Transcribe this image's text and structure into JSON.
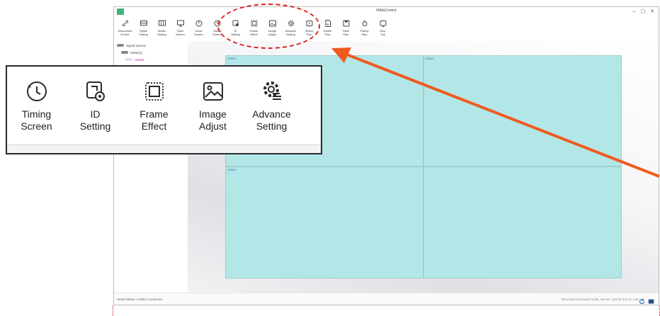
{
  "window": {
    "title": "MiMaControl",
    "controls": [
      "–",
      "▢",
      "✕"
    ]
  },
  "toolbar": {
    "buttons": [
      {
        "label": "Disconnect\nDevice",
        "icon": "link-icon"
      },
      {
        "label": "Splice\nSetting",
        "icon": "splice-icon"
      },
      {
        "label": "Matrix\nSetting",
        "icon": "matrix-icon"
      },
      {
        "label": "Open\nScreen",
        "icon": "monitor-icon"
      },
      {
        "label": "Close\nScreen",
        "icon": "power-icon"
      },
      {
        "label": "Timing\nScreen",
        "icon": "clock-icon"
      },
      {
        "label": "ID\nSetting",
        "icon": "id-icon"
      },
      {
        "label": "Frame\nEffect",
        "icon": "frame-icon"
      },
      {
        "label": "Image\nAdjust",
        "icon": "image-icon"
      },
      {
        "label": "Advance\nSetting",
        "icon": "gear-icon"
      },
      {
        "label": "Select\nPlan",
        "icon": "select-icon"
      },
      {
        "label": "Delete\nPlan",
        "icon": "delete-icon"
      },
      {
        "label": "Save\nPlan",
        "icon": "save-icon"
      },
      {
        "label": "Polling\nPlan",
        "icon": "polling-icon"
      },
      {
        "label": "Help\nTool",
        "icon": "help-icon"
      }
    ]
  },
  "sidebar": {
    "root": "Signal Source",
    "group": "HDMI(1)",
    "item": "HDMI1"
  },
  "canvas": {
    "cells": [
      "HDMI1",
      "HDMI1",
      "HDMI1",
      ""
    ],
    "fill_color": "#b3e6e6"
  },
  "status": {
    "left": "Serial Status: COM3 Connected",
    "right": "Received command mode, Server: 128.96 Dot 21.1.96"
  },
  "zoom": {
    "buttons": [
      {
        "label": "Timing\nScreen",
        "icon": "clock-icon"
      },
      {
        "label": "ID\nSetting",
        "icon": "id-icon"
      },
      {
        "label": "Frame\nEffect",
        "icon": "frame-icon"
      },
      {
        "label": "Image\nAdjust",
        "icon": "image-icon"
      },
      {
        "label": "Advance\nSetting",
        "icon": "gear-icon"
      }
    ]
  },
  "colors": {
    "highlight": "#e02020",
    "arrow": "#f05a1e",
    "cell_fill": "#b3e6e6"
  }
}
